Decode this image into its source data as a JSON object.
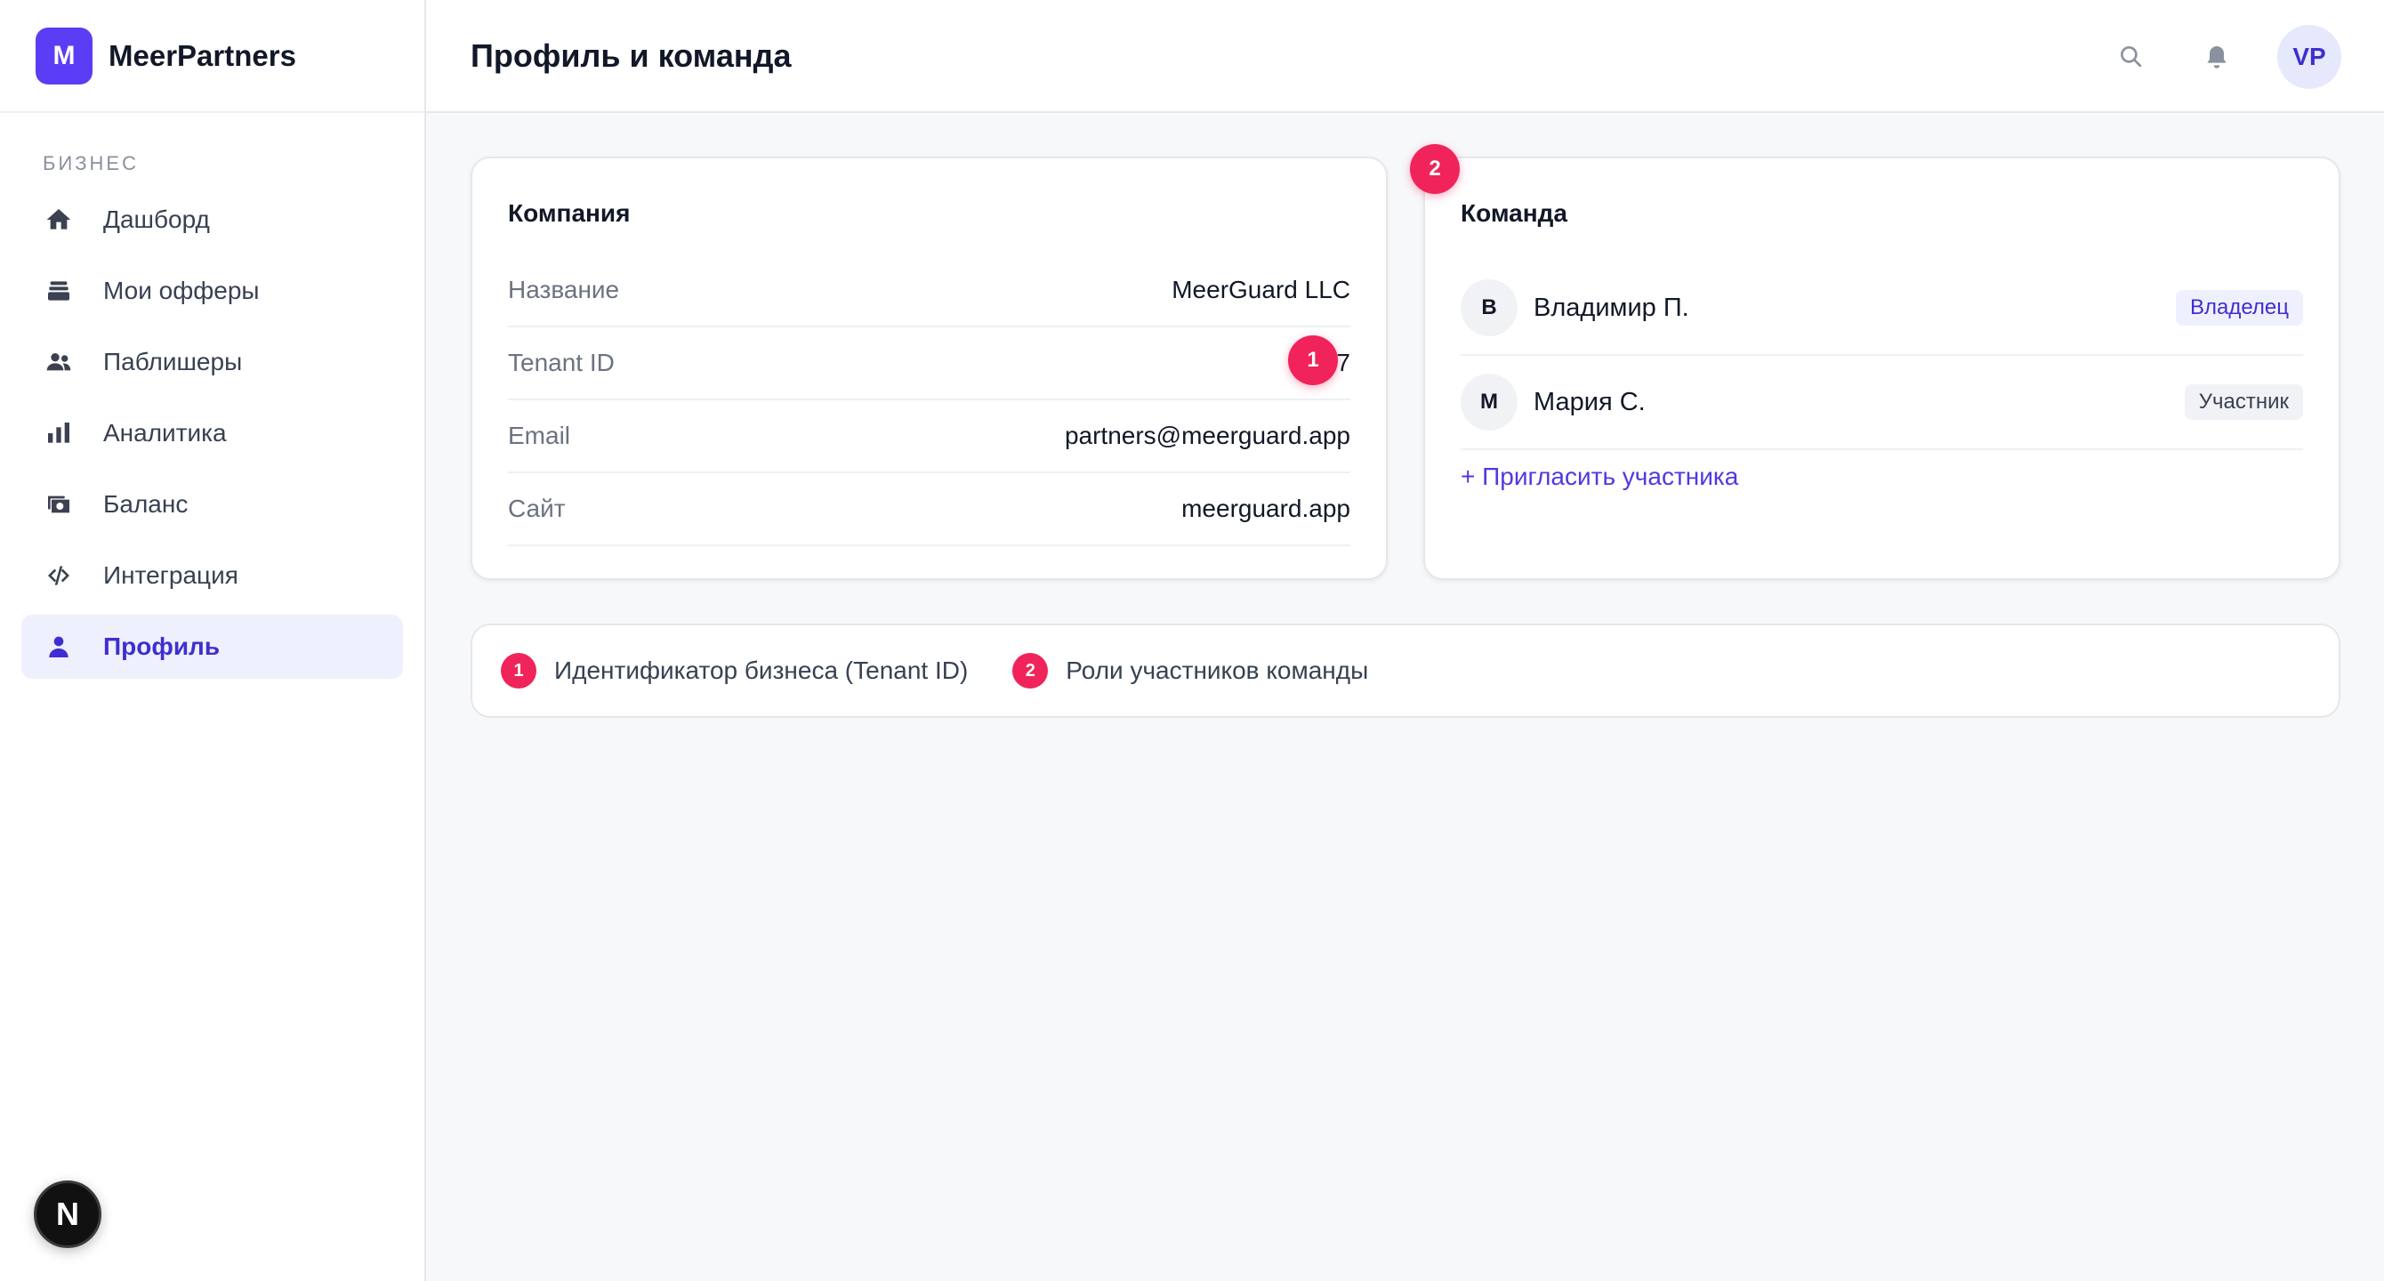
{
  "brand": {
    "logo_letter": "M",
    "name": "MeerPartners",
    "accent": "#5b3df5"
  },
  "sidebar": {
    "section_label": "БИЗНЕС",
    "items": [
      {
        "label": "Дашборд",
        "icon": "home-icon"
      },
      {
        "label": "Мои офферы",
        "icon": "stack-icon"
      },
      {
        "label": "Паблишеры",
        "icon": "people-icon"
      },
      {
        "label": "Аналитика",
        "icon": "bar-chart-icon"
      },
      {
        "label": "Баланс",
        "icon": "wallet-icon"
      },
      {
        "label": "Интеграция",
        "icon": "code-icon"
      },
      {
        "label": "Профиль",
        "icon": "user-icon",
        "active": true
      }
    ]
  },
  "header": {
    "title": "Профиль и команда",
    "avatar_initials": "VP"
  },
  "company_card": {
    "title": "Компания",
    "rows": [
      {
        "key": "Название",
        "value": "MeerGuard LLC"
      },
      {
        "key": "Tenant ID",
        "value": "7"
      },
      {
        "key": "Email",
        "value": "partners@meerguard.app"
      },
      {
        "key": "Сайт",
        "value": "meerguard.app"
      }
    ]
  },
  "team_card": {
    "title": "Команда",
    "members": [
      {
        "initial": "В",
        "name": "Владимир П.",
        "role": "Владелец"
      },
      {
        "initial": "М",
        "name": "Мария С.",
        "role": "Участник"
      }
    ],
    "invite_label": "+ Пригласить участника"
  },
  "markers": {
    "one": "1",
    "two": "2"
  },
  "legend": {
    "items": [
      {
        "number": "1",
        "text": "Идентификатор бизнеса (Tenant ID)"
      },
      {
        "number": "2",
        "text": "Роли участников команды"
      }
    ]
  },
  "dev_badge": "N",
  "colors": {
    "marker": "#f0245a",
    "active_nav_bg": "#eef0fd",
    "active_nav_text": "#3f2fd0"
  }
}
